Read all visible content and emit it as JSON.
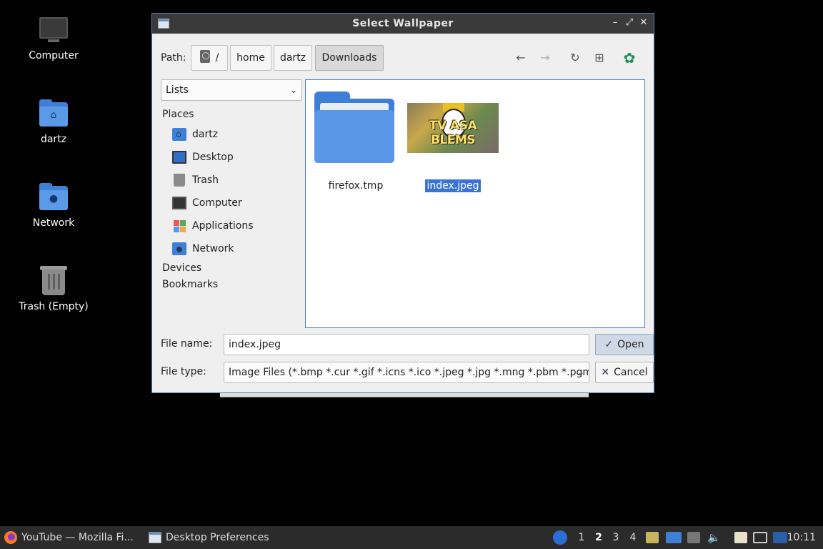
{
  "desktop": {
    "icons": [
      {
        "label": "Computer",
        "icon": "computer-icon"
      },
      {
        "label": "dartz",
        "icon": "home-folder-icon"
      },
      {
        "label": "Network",
        "icon": "network-folder-icon"
      },
      {
        "label": "Trash (Empty)",
        "icon": "trash-icon"
      }
    ]
  },
  "dialog": {
    "title": "Select Wallpaper",
    "path_label": "Path:",
    "breadcrumbs": [
      "/",
      "home",
      "dartz",
      "Downloads"
    ],
    "active_crumb": "Downloads",
    "view_mode": "Lists",
    "sidebar": {
      "places_label": "Places",
      "places": [
        {
          "label": "dartz",
          "icon": "home-folder-icon"
        },
        {
          "label": "Desktop",
          "icon": "desktop-icon"
        },
        {
          "label": "Trash",
          "icon": "trash-icon"
        },
        {
          "label": "Computer",
          "icon": "computer-icon"
        },
        {
          "label": "Applications",
          "icon": "applications-icon"
        },
        {
          "label": "Network",
          "icon": "network-folder-icon"
        }
      ],
      "devices_label": "Devices",
      "bookmarks_label": "Bookmarks"
    },
    "files": [
      {
        "name": "firefox.tmp",
        "type": "folder",
        "selected": false
      },
      {
        "name": "index.jpeg",
        "type": "image",
        "selected": true,
        "thumb_text": "TV ASA  BLEMS"
      }
    ],
    "file_name_label": "File name:",
    "file_name_value": "index.jpeg",
    "file_type_label": "File type:",
    "file_type_value": "Image Files (*.bmp *.cur *.gif *.icns *.ico *.jpeg *.jpg *.mng *.pbm *.pgm",
    "open_label": "Open",
    "cancel_label": "Cancel"
  },
  "taskbar": {
    "tasks": [
      {
        "label": "YouTube — Mozilla Fi...",
        "icon": "firefox-icon"
      },
      {
        "label": "Desktop Preferences",
        "icon": "window-icon"
      }
    ],
    "workspaces": [
      "1",
      "2",
      "3",
      "4"
    ],
    "current_workspace": "2",
    "clock": "10:11"
  },
  "colors": {
    "accent": "#3874d8",
    "folder": "#5a97e6",
    "titlebar": "#3a3a3a",
    "taskbar": "#2b2b2b"
  }
}
